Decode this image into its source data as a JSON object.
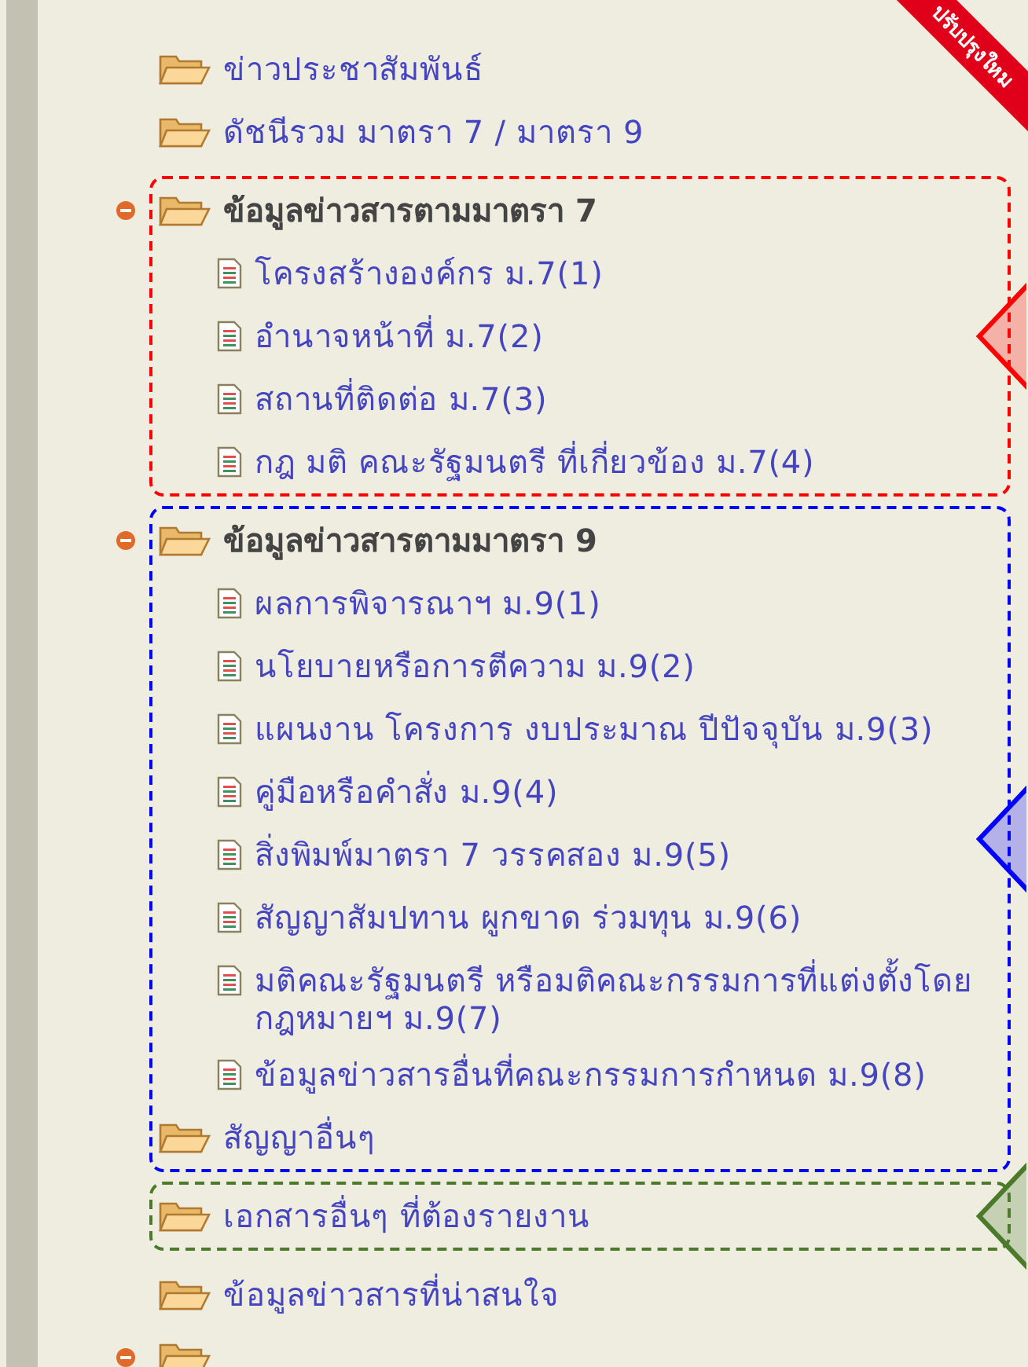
{
  "ribbon": {
    "label": "ปรับปรุงใหม"
  },
  "sections": [
    {
      "items": [
        {
          "kind": "folder",
          "label": "ข่าวประชาสัมพันธ์"
        },
        {
          "kind": "folder",
          "label": "ดัชนีรวม มาตรา 7 / มาตรา 9"
        }
      ]
    },
    {
      "color": "#ff0000",
      "items": [
        {
          "kind": "group",
          "expanded": true,
          "label": "ข้อมูลข่าวสารตามมาตรา 7",
          "children": [
            {
              "label": "โครงสร้างองค์กร ม.7(1)"
            },
            {
              "label": "อำนาจหน้าที่ ม.7(2)"
            },
            {
              "label": "สถานที่ติดต่อ ม.7(3)"
            },
            {
              "label": "กฎ มติ คณะรัฐมนตรี ที่เกี่ยวข้อง ม.7(4)"
            }
          ]
        }
      ]
    },
    {
      "color": "#0000ff",
      "items": [
        {
          "kind": "group",
          "expanded": true,
          "label": "ข้อมูลข่าวสารตามมาตรา 9",
          "children": [
            {
              "label": "ผลการพิจารณาฯ ม.9(1)"
            },
            {
              "label": "นโยบายหรือการตีความ ม.9(2)"
            },
            {
              "label": "แผนงาน โครงการ งบประมาณ ปีปัจจุบัน ม.9(3)"
            },
            {
              "label": "คู่มือหรือคำสั่ง ม.9(4)"
            },
            {
              "label": "สิ่งพิมพ์มาตรา 7 วรรคสอง ม.9(5)"
            },
            {
              "label": "สัญญาสัมปทาน ผูกขาด ร่วมทุน ม.9(6)"
            },
            {
              "label": "มติคณะรัฐมนตรี หรือมติคณะกรรมการที่แต่งตั้งโดยกฎหมายฯ ม.9(7)"
            },
            {
              "label": "ข้อมูลข่าวสารอื่นที่คณะกรรมการกำหนด ม.9(8)"
            }
          ]
        },
        {
          "kind": "folder",
          "label": "สัญญาอื่นๆ"
        }
      ]
    },
    {
      "color": "#4a7a2a",
      "items": [
        {
          "kind": "folder",
          "label": "เอกสารอื่นๆ ที่ต้องรายงาน"
        }
      ]
    },
    {
      "items": [
        {
          "kind": "folder",
          "label": "ข้อมูลข่าวสารที่น่าสนใจ"
        },
        {
          "kind": "group",
          "expanded": true
        }
      ]
    }
  ]
}
